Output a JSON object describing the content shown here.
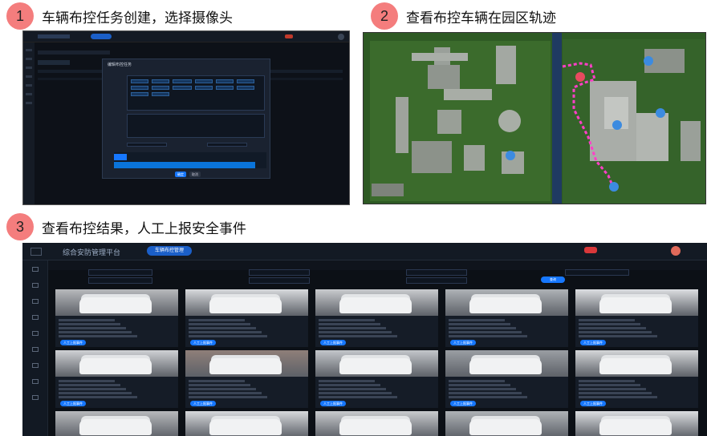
{
  "steps": [
    {
      "number": "1",
      "title": "车辆布控任务创建，选择摄像头"
    },
    {
      "number": "2",
      "title": "查看布控车辆在园区轨迹"
    },
    {
      "number": "3",
      "title": "查看布控结果，人工上报安全事件"
    }
  ],
  "panel1": {
    "dialog_title": "编辑布控任务",
    "confirm_label": "确定",
    "cancel_label": "取消"
  },
  "panel3": {
    "brand": "综合安防管理平台",
    "active_tab": "车辆布控管理",
    "query_label": "查询",
    "report_label": "人工上报事件",
    "colors": {
      "accent": "#1677ff",
      "trail": "#ff3fc8"
    }
  }
}
